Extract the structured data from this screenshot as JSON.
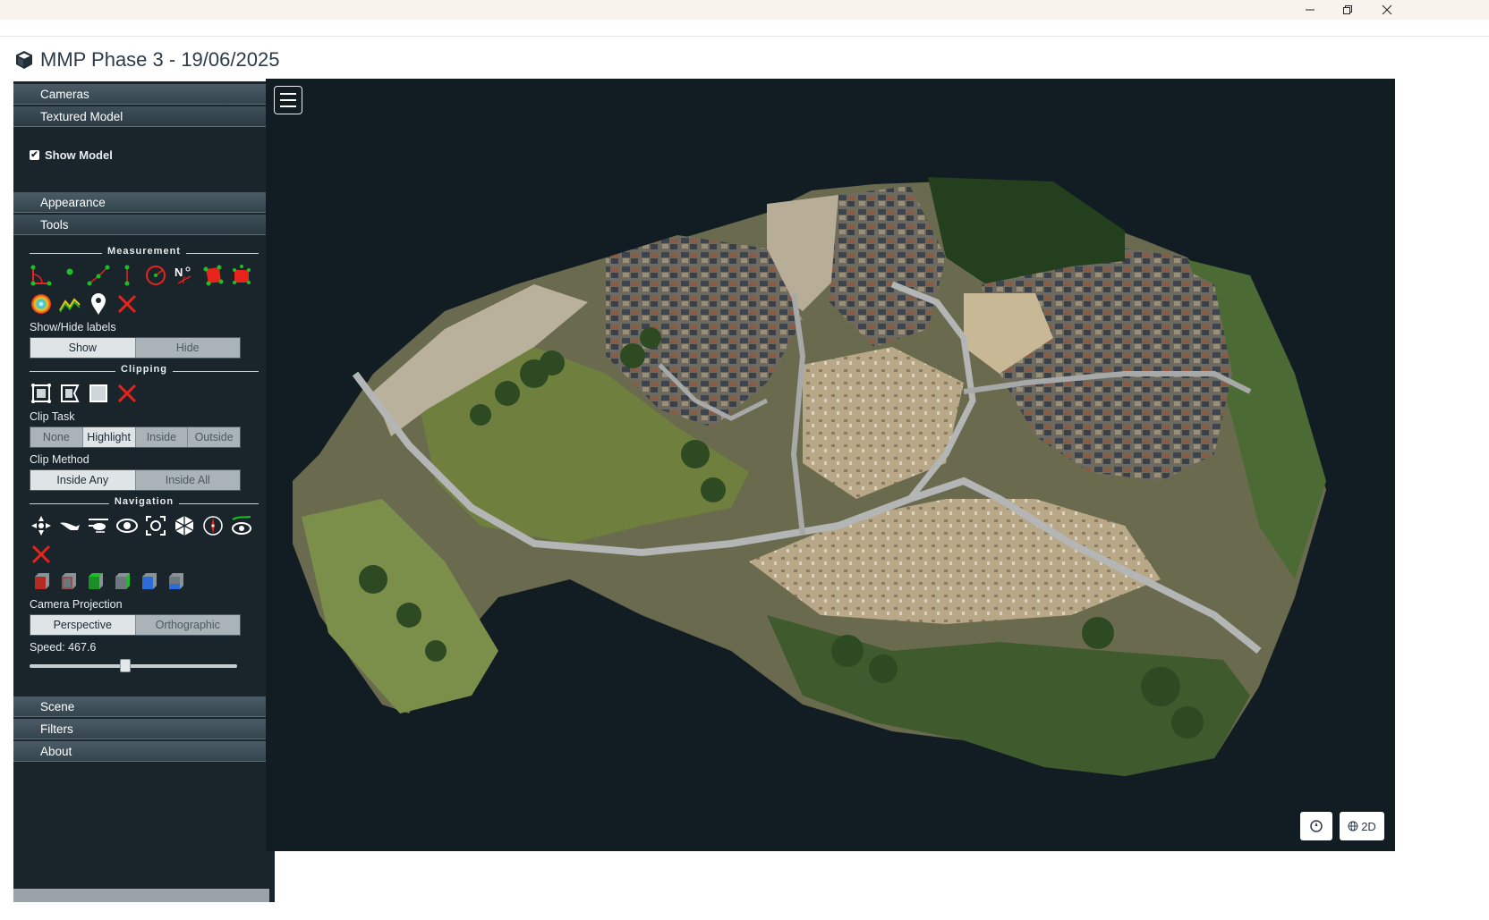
{
  "window": {
    "minimize_icon": "minimize-icon",
    "restore_icon": "restore-icon",
    "close_icon": "close-icon"
  },
  "app": {
    "title": "MMP Phase 3 - 19/06/2025",
    "icon": "cube-icon"
  },
  "sidebar": {
    "sections": {
      "cameras": "Cameras",
      "textured_model": "Textured Model",
      "appearance": "Appearance",
      "tools": "Tools",
      "scene": "Scene",
      "filters": "Filters",
      "about": "About"
    },
    "textured_model": {
      "show_model_label": "Show Model",
      "show_model_checked": true
    },
    "tools": {
      "measurement": {
        "title": "Measurement",
        "icons": [
          "angle-measure-icon",
          "point-measure-icon",
          "distance-measure-icon",
          "height-measure-icon",
          "circle-measure-icon",
          "azimuth-measure-icon",
          "area-measure-icon",
          "volume-measure-icon",
          "sphere-volume-icon",
          "profile-measure-icon",
          "annotation-pin-icon",
          "remove-measurements-icon"
        ],
        "labels_title": "Show/Hide labels",
        "show": "Show",
        "hide": "Hide"
      },
      "clipping": {
        "title": "Clipping",
        "icons": [
          "clip-volume-icon",
          "clip-polygon-icon",
          "clip-screen-icon",
          "remove-clipping-icon"
        ],
        "clip_task_title": "Clip Task",
        "clip_task_options": [
          "None",
          "Highlight",
          "Inside",
          "Outside"
        ],
        "clip_task_selected": "Highlight",
        "clip_method_title": "Clip Method",
        "clip_method_options": [
          "Inside Any",
          "Inside All"
        ],
        "clip_method_selected": "Inside Any"
      },
      "navigation": {
        "title": "Navigation",
        "icons": [
          "earth-control-icon",
          "fly-control-icon",
          "helicopter-control-icon",
          "orbit-control-icon",
          "focus-icon",
          "full-extent-icon",
          "compass-icon",
          "camera-animation-icon",
          "remove-icon"
        ],
        "view_icons": [
          "left-view-icon",
          "front-view-icon",
          "top-view-icon",
          "back-view-icon",
          "right-view-icon",
          "bottom-view-icon"
        ],
        "projection_title": "Camera Projection",
        "projection_options": [
          "Perspective",
          "Orthographic"
        ],
        "projection_selected": "Perspective",
        "speed_label": "Speed: 467.6",
        "speed_fraction": 0.46
      }
    }
  },
  "viewer": {
    "menu_icon": "hamburger-menu-icon",
    "north_button_icon": "north-arrow-icon",
    "mode_button_label": "2D",
    "mode_button_icon": "globe-icon"
  },
  "colors": {
    "sidebar_bg": "#19252b",
    "viewer_bg": "#111d23",
    "accent_red": "#e8231c",
    "accent_green": "#1bbf26"
  }
}
